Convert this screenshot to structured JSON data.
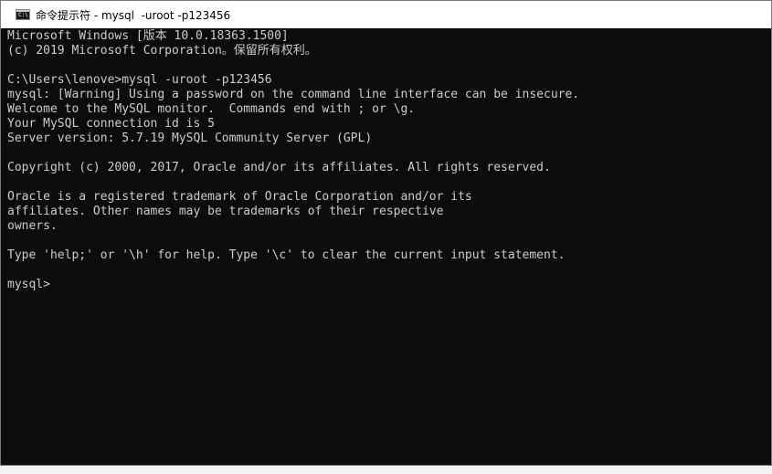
{
  "window": {
    "title": "命令提示符 - mysql  -uroot -p123456",
    "icon": "console-icon"
  },
  "terminal": {
    "lines": [
      "Microsoft Windows [版本 10.0.18363.1500]",
      "(c) 2019 Microsoft Corporation。保留所有权利。",
      "",
      "C:\\Users\\lenove>mysql -uroot -p123456",
      "mysql: [Warning] Using a password on the command line interface can be insecure.",
      "Welcome to the MySQL monitor.  Commands end with ; or \\g.",
      "Your MySQL connection id is 5",
      "Server version: 5.7.19 MySQL Community Server (GPL)",
      "",
      "Copyright (c) 2000, 2017, Oracle and/or its affiliates. All rights reserved.",
      "",
      "Oracle is a registered trademark of Oracle Corporation and/or its",
      "affiliates. Other names may be trademarks of their respective",
      "owners.",
      "",
      "Type 'help;' or '\\h' for help. Type '\\c' to clear the current input statement.",
      "",
      "mysql>"
    ]
  },
  "colors": {
    "console_bg": "#0c0c0c",
    "console_text": "#cccccc",
    "titlebar_bg": "#ffffff"
  }
}
